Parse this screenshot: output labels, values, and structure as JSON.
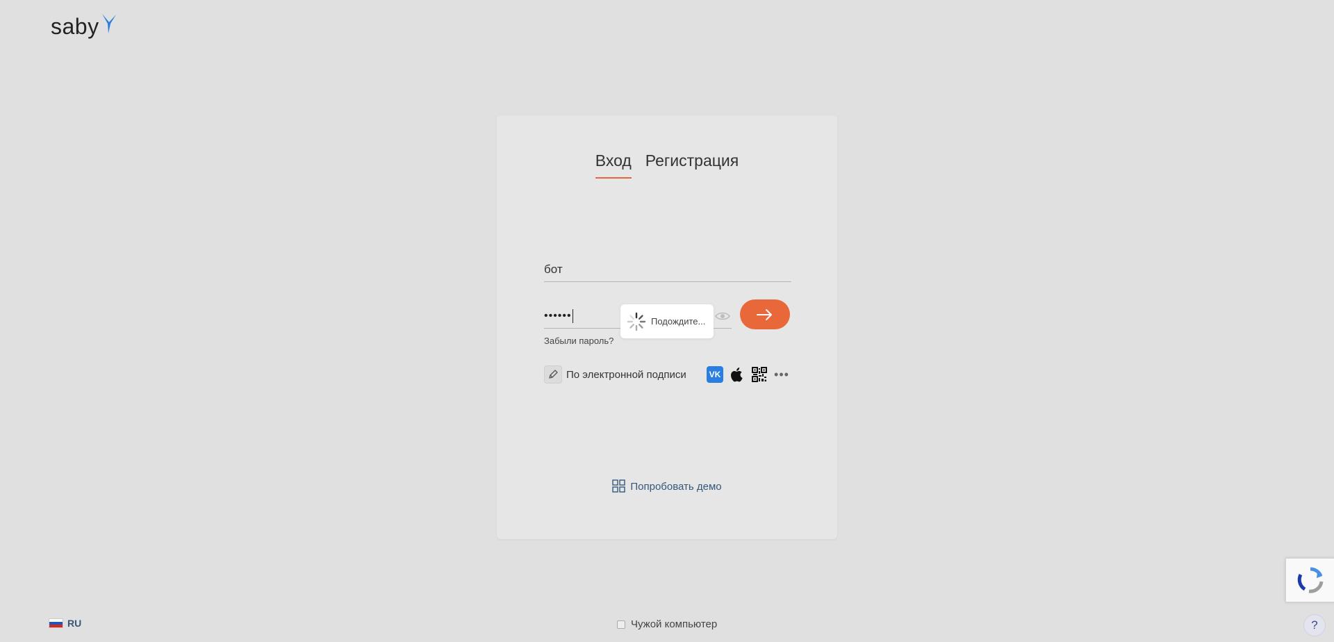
{
  "brand": {
    "name": "saby"
  },
  "tabs": [
    {
      "label": "Вход",
      "active": true
    },
    {
      "label": "Регистрация",
      "active": false
    }
  ],
  "login": {
    "value": "бот"
  },
  "password": {
    "masked_value": "••••••"
  },
  "loader": {
    "text": "Подождите..."
  },
  "forgot_password": "Забыли пароль?",
  "esign": {
    "label": "По электронной подписи"
  },
  "socials": [
    {
      "name": "vk-icon",
      "glyph": "VK"
    },
    {
      "name": "apple-icon"
    },
    {
      "name": "qr-code-icon"
    },
    {
      "name": "more-icon",
      "glyph": "•••"
    }
  ],
  "demo": {
    "label": "Попробовать демо"
  },
  "language": {
    "code": "RU"
  },
  "foreign_computer": {
    "label": "Чужой компьютер",
    "checked": false
  },
  "help": {
    "glyph": "?"
  },
  "colors": {
    "accent": "#e8683a",
    "link": "#35577a",
    "background": "#e0e0e0",
    "vk": "#2a7de1"
  }
}
